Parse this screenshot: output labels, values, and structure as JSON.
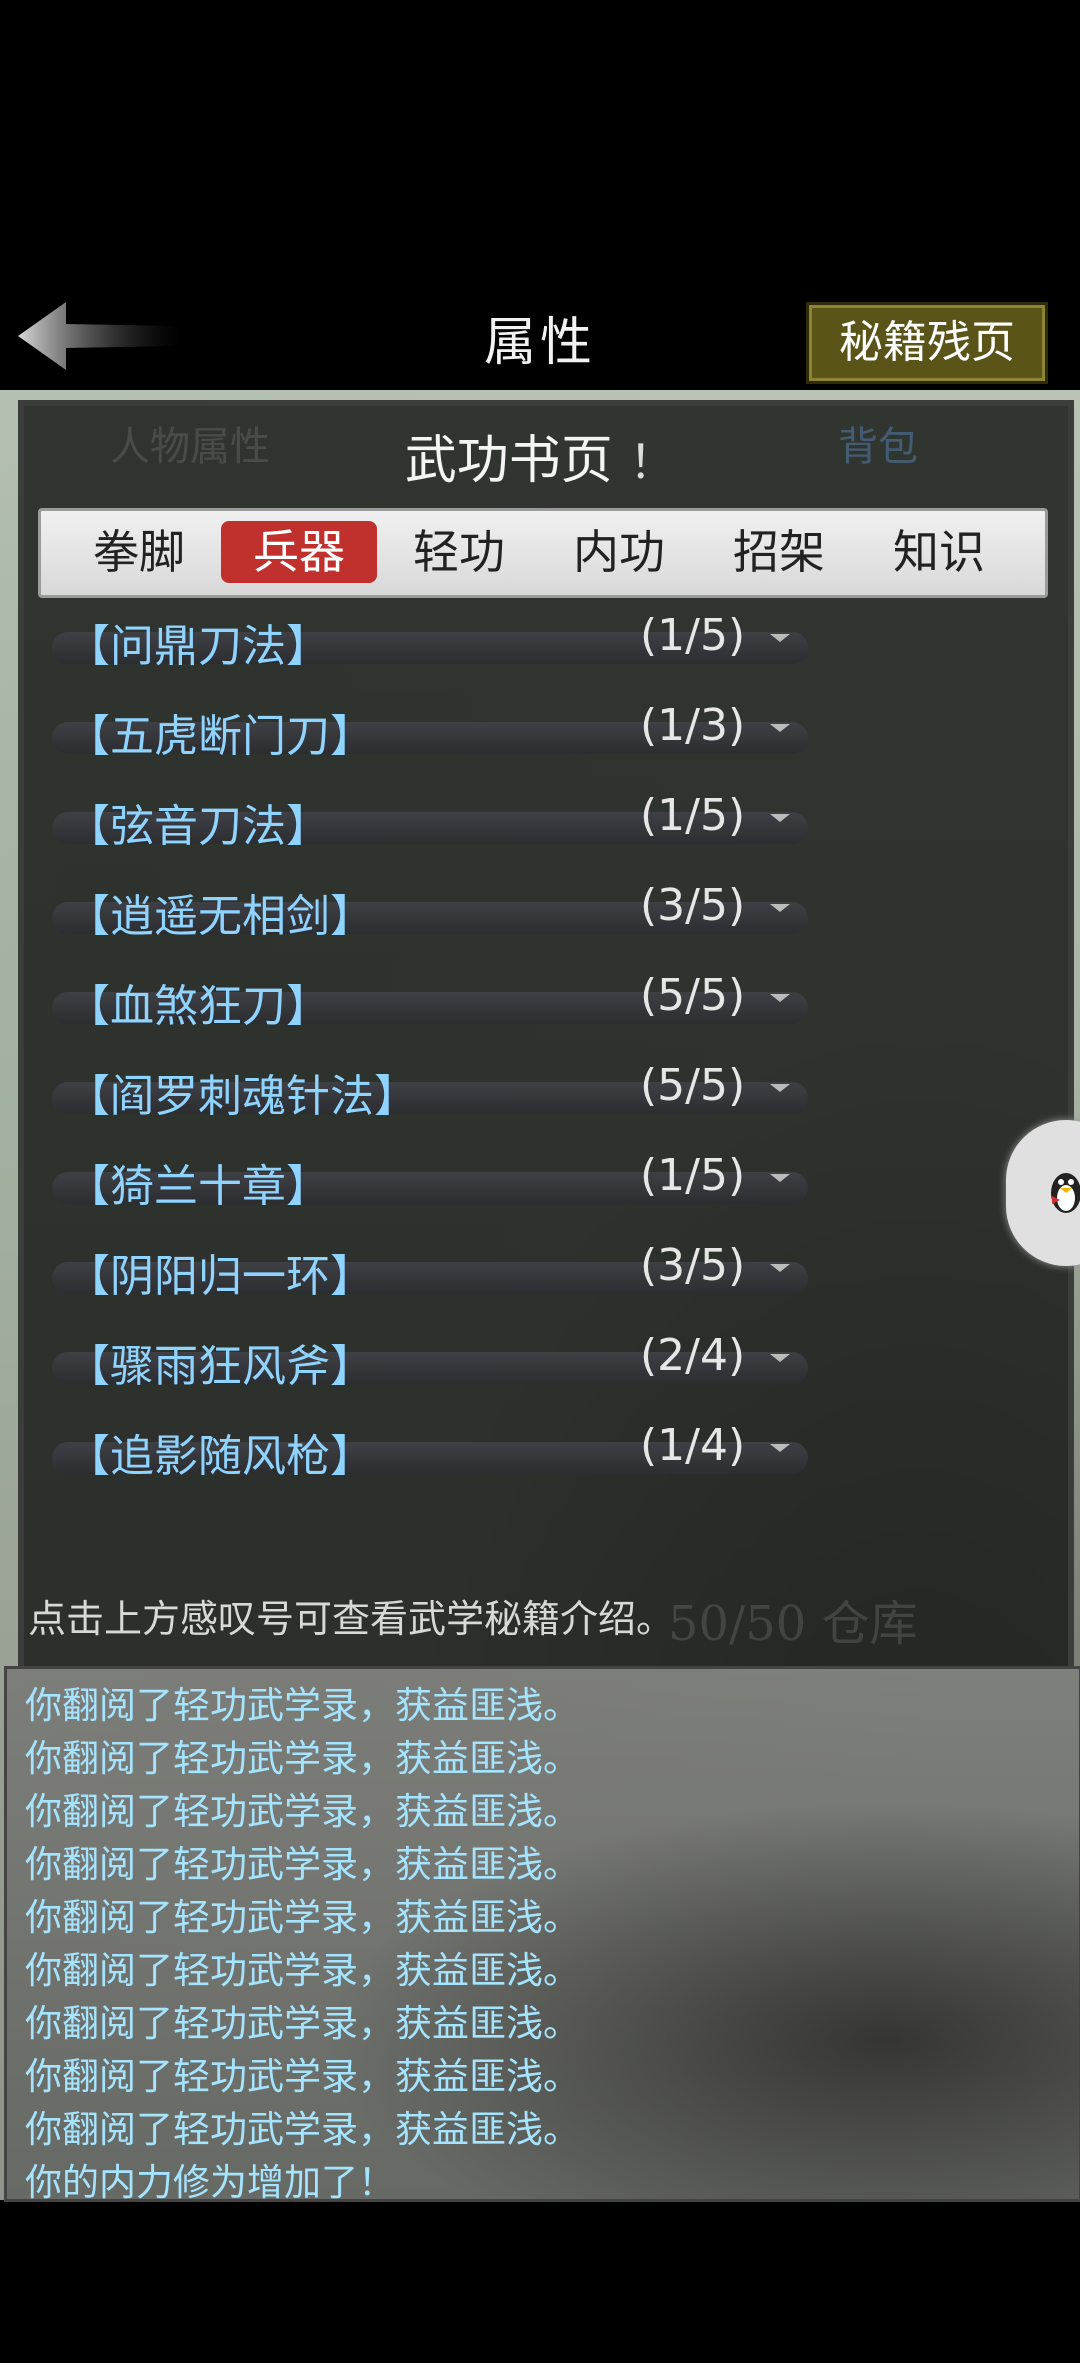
{
  "header": {
    "title": "属性",
    "secret_pages_button": "秘籍残页"
  },
  "background": {
    "tab_left": "人物属性",
    "tab_right": "背包",
    "footer_text": "50/50 仓库"
  },
  "dialog": {
    "title": "武功书页",
    "exclamation": "！",
    "tabs": [
      {
        "label": "拳脚"
      },
      {
        "label": "兵器",
        "active": true
      },
      {
        "label": "轻功"
      },
      {
        "label": "内功"
      },
      {
        "label": "招架"
      },
      {
        "label": "知识"
      }
    ],
    "skills": [
      {
        "name": "【问鼎刀法】",
        "progress": "(1/5)"
      },
      {
        "name": "【五虎断门刀】",
        "progress": "(1/3)"
      },
      {
        "name": "【弦音刀法】",
        "progress": "(1/5)"
      },
      {
        "name": "【逍遥无相剑】",
        "progress": "(3/5)"
      },
      {
        "name": "【血煞狂刀】",
        "progress": "(5/5)"
      },
      {
        "name": "【阎罗刺魂针法】",
        "progress": "(5/5)"
      },
      {
        "name": "【猗兰十章】",
        "progress": "(1/5)"
      },
      {
        "name": "【阴阳归一环】",
        "progress": "(3/5)"
      },
      {
        "name": "【骤雨狂风斧】",
        "progress": "(2/4)"
      },
      {
        "name": "【追影随风枪】",
        "progress": "(1/4)"
      }
    ],
    "hint": "点击上方感叹号可查看武学秘籍介绍。"
  },
  "log": {
    "lines": [
      "你翻阅了轻功武学录，获益匪浅。",
      "你翻阅了轻功武学录，获益匪浅。",
      "你翻阅了轻功武学录，获益匪浅。",
      "你翻阅了轻功武学录，获益匪浅。",
      "你翻阅了轻功武学录，获益匪浅。",
      "你翻阅了轻功武学录，获益匪浅。",
      "你翻阅了轻功武学录，获益匪浅。",
      "你翻阅了轻功武学录，获益匪浅。",
      "你翻阅了轻功武学录，获益匪浅。",
      "你的内力修为增加了！"
    ]
  },
  "colors": {
    "active_tab": "#c0302d",
    "skill_name": "#8fd3ff",
    "log_text": "#a5e4ff",
    "secret_button": "#5a5418"
  }
}
